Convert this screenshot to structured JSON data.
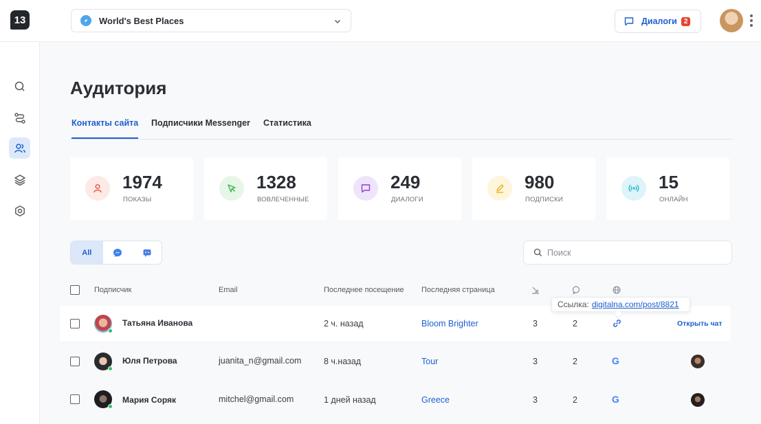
{
  "header": {
    "logo": "13",
    "site_name": "World's Best Places",
    "dialogs_label": "Диалоги",
    "dialogs_count": "2"
  },
  "sidebar": {
    "items": [
      {
        "icon": "search-icon",
        "active": false
      },
      {
        "icon": "routes-icon",
        "active": false
      },
      {
        "icon": "users-icon",
        "active": true
      },
      {
        "icon": "layers-icon",
        "active": false
      },
      {
        "icon": "settings-hex-icon",
        "active": false
      }
    ]
  },
  "page": {
    "title": "Аудитория",
    "tabs": [
      {
        "label": "Контакты сайта",
        "active": true
      },
      {
        "label": "Подписчики Messenger",
        "active": false
      },
      {
        "label": "Статистика",
        "active": false
      }
    ]
  },
  "stats": [
    {
      "value": "1974",
      "label": "ПОКАЗЫ",
      "icon": "user-icon",
      "color": "#e8563f",
      "bg": "#fde9e5"
    },
    {
      "value": "1328",
      "label": "ВОВЛЕЧЕННЫЕ",
      "icon": "cursor-icon",
      "color": "#3cb548",
      "bg": "#e6f6e7"
    },
    {
      "value": "249",
      "label": "ДИАЛОГИ",
      "icon": "chat-icon",
      "color": "#8a3fd6",
      "bg": "#efe5fa"
    },
    {
      "value": "980",
      "label": "ПОДПИСКИ",
      "icon": "pen-icon",
      "color": "#e9b418",
      "bg": "#fdf5dc"
    },
    {
      "value": "15",
      "label": "ОНЛАЙН",
      "icon": "broadcast-icon",
      "color": "#1fb5d3",
      "bg": "#ddf4f9"
    }
  ],
  "filters": {
    "all_label": "All",
    "options": [
      "messenger-icon",
      "chat-bot-icon"
    ]
  },
  "search": {
    "placeholder": "Поиск",
    "value": ""
  },
  "table": {
    "headers": {
      "subscriber": "Подписчик",
      "email": "Email",
      "last_visit": "Последнее посещение",
      "last_page": "Последняя страница"
    },
    "header_icons": [
      "visits-icon",
      "messages-icon",
      "source-globe-icon"
    ],
    "rows": [
      {
        "name": "Татьяна Иванова",
        "email": "",
        "last_visit": "2 ч. назад",
        "last_page": "Bloom Brighter",
        "visits": "3",
        "messages": "2",
        "source": "link-icon",
        "action": "Открыть чат"
      },
      {
        "name": "Юля Петрова",
        "email": "juanita_n@gmail.com",
        "last_visit": "8 ч.назад",
        "last_page": "Tour",
        "visits": "3",
        "messages": "2",
        "source": "google-icon",
        "action": ""
      },
      {
        "name": "Мария Соряк",
        "email": "mitchel@gmail.com",
        "last_visit": "1 дней назад",
        "last_page": "Greece",
        "visits": "3",
        "messages": "2",
        "source": "google-icon",
        "action": ""
      }
    ]
  },
  "tooltip": {
    "prefix": "Ссылка:",
    "link": "digitalna.com/post/8821"
  },
  "colors": {
    "accent": "#1e5fd1",
    "online": "#2ec26a",
    "badge": "#e8432e"
  }
}
